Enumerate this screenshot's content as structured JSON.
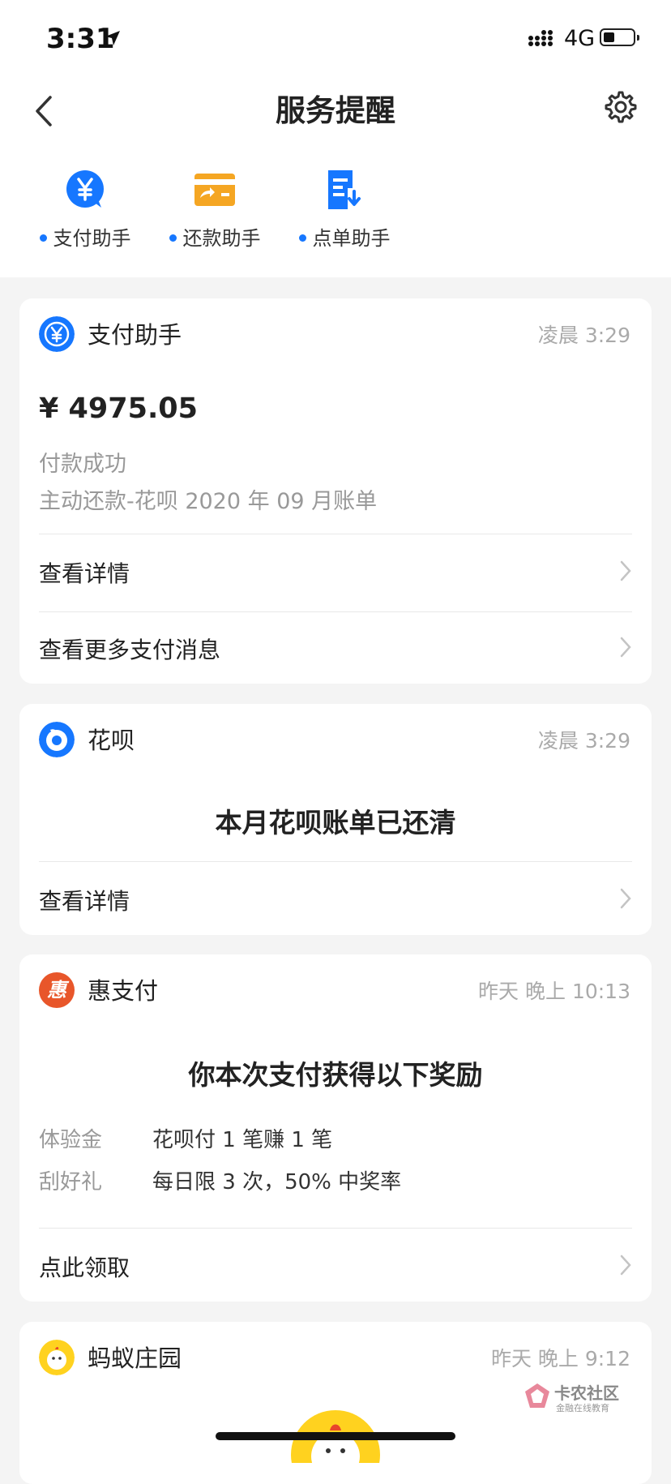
{
  "status_bar": {
    "time": "3:31",
    "network": "4G"
  },
  "nav": {
    "title": "服务提醒"
  },
  "quick_actions": [
    {
      "label": "支付助手",
      "icon": "yuan-bubble-icon"
    },
    {
      "label": "还款助手",
      "icon": "card-repay-icon"
    },
    {
      "label": "点单助手",
      "icon": "order-download-icon"
    }
  ],
  "cards": {
    "payment": {
      "name": "支付助手",
      "time": "凌晨 3:29",
      "amount": "¥ 4975.05",
      "status": "付款成功",
      "desc": "主动还款-花呗 2020 年 09 月账单",
      "rows": [
        "查看详情",
        "查看更多支付消息"
      ]
    },
    "huabei": {
      "name": "花呗",
      "time": "凌晨 3:29",
      "title": "本月花呗账单已还清",
      "row": "查看详情"
    },
    "huizhifu": {
      "name": "惠支付",
      "logo_char": "惠",
      "time": "昨天 晚上 10:13",
      "title": "你本次支付获得以下奖励",
      "items": [
        {
          "key": "体验金",
          "value": "花呗付 1 笔赚 1 笔"
        },
        {
          "key": "刮好礼",
          "value": "每日限 3 次，50% 中奖率"
        }
      ],
      "row": "点此领取"
    },
    "farm": {
      "name": "蚂蚁庄园",
      "time": "昨天 晚上 9:12"
    }
  },
  "watermark": {
    "title": "卡农社区",
    "subtitle": "金融在线教育"
  },
  "colors": {
    "accent": "#1677ff",
    "orange": "#f5a623",
    "hui": "#e8562a",
    "farm": "#ffd21f"
  }
}
